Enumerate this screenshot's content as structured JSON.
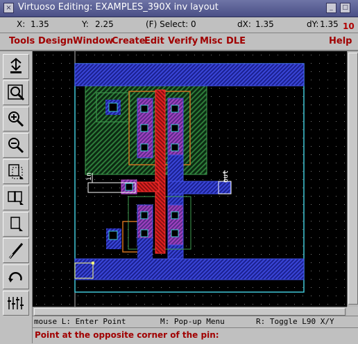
{
  "window": {
    "title": "Virtuoso Editing: EXAMPLES_390X inv layout",
    "close_glyph": "×",
    "min_glyph": "_",
    "max_glyph": "□"
  },
  "status": {
    "x_label": "X:",
    "x_value": "1.35",
    "y_label": "Y:",
    "y_value": "2.25",
    "select": "(F) Select: 0",
    "dx_label": "dX:",
    "dx_value": "1.35",
    "dy_label": "dY:",
    "dy_value": "1.35",
    "command_number": "10"
  },
  "menu": {
    "items": [
      "Tools",
      "Design",
      "Window",
      "Create",
      "Edit",
      "Verify",
      "Misc",
      "DLE"
    ],
    "help": "Help"
  },
  "toolbar": {
    "icons": [
      "save-icon",
      "zoom-fit-icon",
      "zoom-in-icon",
      "zoom-out-icon",
      "stretch-icon",
      "copy-icon",
      "move-icon",
      "path-icon",
      "undo-icon",
      "ruler-icon"
    ]
  },
  "layout": {
    "pin_in_label": "in",
    "pin_out_label": "out"
  },
  "mousebar": {
    "left": "mouse L: Enter Point",
    "middle": "M: Pop-up Menu",
    "right": "R: Toggle L90 X/Y"
  },
  "prompt": {
    "text": "Point at the opposite corner of the pin:"
  },
  "colors": {
    "menu_text": "#a00000",
    "canvas_bg": "#000000",
    "nwell": "#2e7d3a",
    "metal1": "#3a46d8",
    "poly": "#e02020",
    "diffusion": "#d07020"
  }
}
